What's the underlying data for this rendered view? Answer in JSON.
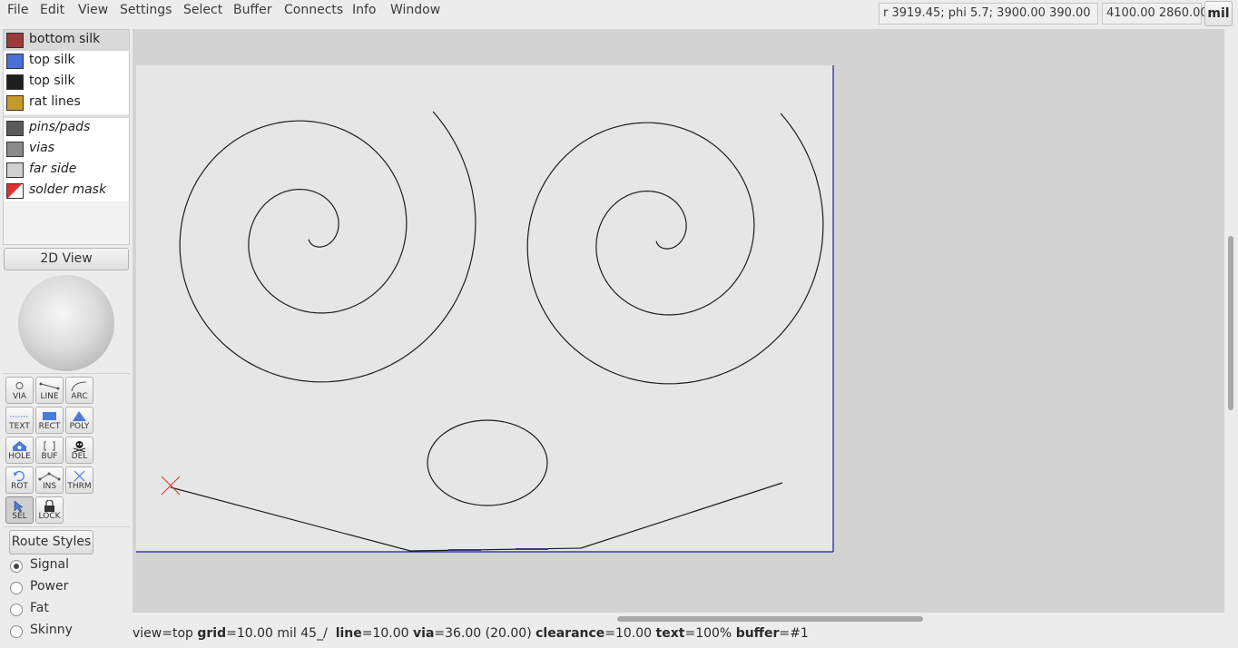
{
  "menubar": {
    "items": [
      "File",
      "Edit",
      "View",
      "Settings",
      "Select",
      "Buffer",
      "Connects",
      "Info",
      "Window"
    ],
    "cursor_readout": "r 3919.45; phi 5.7; 3900.00 390.00",
    "position_readout": "4100.00 2860.00",
    "unit_label": "mil"
  },
  "layers": [
    {
      "label": "bottom silk",
      "color": "#9b3a3a",
      "italic": false,
      "selected": true
    },
    {
      "label": "top silk",
      "color": "#4a6fd6",
      "italic": false,
      "selected": false
    },
    {
      "label": "top silk",
      "color": "#1e1e1e",
      "italic": false,
      "selected": false
    },
    {
      "label": "rat lines",
      "color": "#c59a2a",
      "italic": false,
      "selected": false
    },
    {
      "label": "pins/pads",
      "color": "#5a5a5a",
      "italic": true,
      "selected": false
    },
    {
      "label": "vias",
      "color": "#8a8a8a",
      "italic": true,
      "selected": false
    },
    {
      "label": "far side",
      "color": "#d0d0d0",
      "italic": true,
      "selected": false
    },
    {
      "label": "solder mask",
      "color": "#e03030",
      "italic": true,
      "selected": false
    }
  ],
  "view_button": "2D View",
  "tools": [
    {
      "label": "VIA",
      "icon": "via-icon"
    },
    {
      "label": "LINE",
      "icon": "line-icon"
    },
    {
      "label": "ARC",
      "icon": "arc-icon"
    },
    {
      "label": "TEXT",
      "icon": "text-icon"
    },
    {
      "label": "RECT",
      "icon": "rect-icon"
    },
    {
      "label": "POLY",
      "icon": "poly-icon"
    },
    {
      "label": "HOLE",
      "icon": "hole-icon"
    },
    {
      "label": "BUF",
      "icon": "buffer-icon"
    },
    {
      "label": "DEL",
      "icon": "delete-icon"
    },
    {
      "label": "ROT",
      "icon": "rotate-icon"
    },
    {
      "label": "INS",
      "icon": "insert-icon"
    },
    {
      "label": "THRM",
      "icon": "thermal-icon"
    },
    {
      "label": "SEL",
      "icon": "select-icon",
      "active": true
    },
    {
      "label": "LOCK",
      "icon": "lock-icon"
    }
  ],
  "route_styles": {
    "button": "Route Styles",
    "options": [
      {
        "label": "Signal",
        "checked": true
      },
      {
        "label": "Power",
        "checked": false
      },
      {
        "label": "Fat",
        "checked": false
      },
      {
        "label": "Skinny",
        "checked": false
      }
    ]
  },
  "statusbar": {
    "view_key": "view",
    "view_val": "=top",
    "grid_key": "grid",
    "grid_val": "=10.00 mil",
    "angle": "45_/",
    "line_key": "line",
    "line_val": "=10.00",
    "via_key": "via",
    "via_val": "=36.00 (20.00)",
    "clearance_key": "clearance",
    "clearance_val": "=10.00",
    "text_key": "text",
    "text_val": "=100%",
    "buffer_key": "buffer",
    "buffer_val": "=#1"
  },
  "colors": {
    "board": "#e6e6e6",
    "board_border": "#1a1aa8",
    "trace": "#1e1e1e",
    "cursor_mark": "#e03030"
  }
}
